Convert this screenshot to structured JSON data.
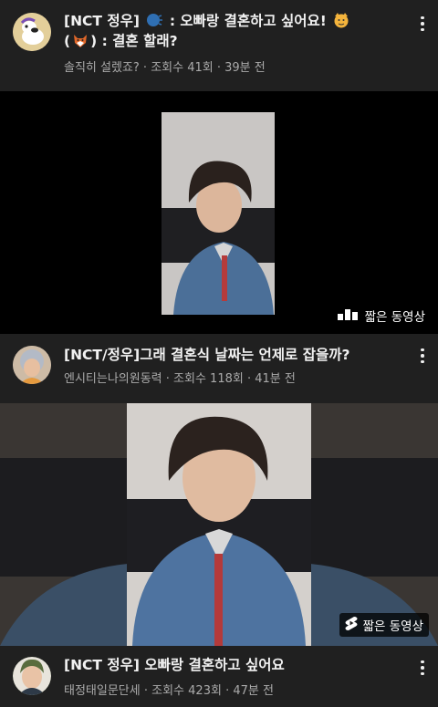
{
  "items": [
    {
      "title_parts": [
        "[NCT 정우]",
        " : 오빠랑 결혼하고 싶어요!",
        "(",
        ") : 결혼 할래?"
      ],
      "channel": "솔직히 설렜죠?",
      "views": "조회수 41회",
      "age": "39분 전",
      "icons": [
        "speaking-head-emoji",
        "cat-face-emoji",
        "fox-face-emoji"
      ]
    },
    {
      "title": "[NCT/정우]그래 결혼식 날짜는 언제로 잡을까?",
      "channel": "엔시티는나의원동력",
      "views": "조회수 118회",
      "age": "41분 전"
    },
    {
      "title": "[NCT 정우] 오빠랑 결혼하고 싶어요",
      "channel": "태정태일문단세",
      "views": "조회수 423회",
      "age": "47분 전"
    }
  ],
  "shorts_label": "짧은 동영상",
  "separator": " · ",
  "colors": {
    "background": "#202020",
    "video_bg": "#000000",
    "meta": "#aaaaaa",
    "text": "#f1f1f1"
  }
}
